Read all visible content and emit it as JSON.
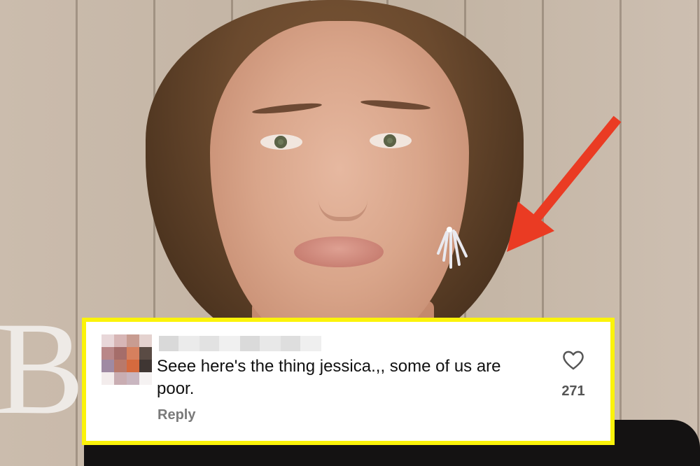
{
  "background": {
    "letters": "B",
    "description_colors": {
      "border": "#fbf30a",
      "arrow": "#ea3b23"
    }
  },
  "comment": {
    "text": "Seee here's the thing jessica.,, some of us are poor.",
    "reply_label": "Reply",
    "like_count": "271",
    "like_icon": "heart-outline-icon"
  }
}
